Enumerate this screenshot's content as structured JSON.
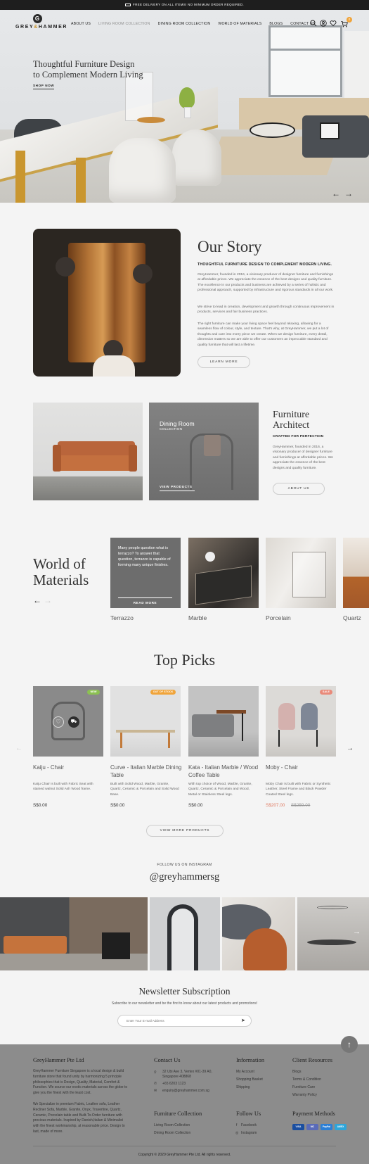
{
  "topbar": {
    "text": "FREE DELIVERY ON ALL ITEMS! NO MINIMUM ORDER REQUIRED."
  },
  "brand": {
    "initial": "G",
    "name_a": "GREY",
    "name_amp": "&",
    "name_b": "HAMMER",
    "accent": "#c9962f"
  },
  "nav": {
    "items": [
      {
        "label": "ABOUT US",
        "active": false
      },
      {
        "label": "LIVING ROOM COLLECTION",
        "active": true
      },
      {
        "label": "DINING ROOM COLLECTION",
        "active": false
      },
      {
        "label": "WORLD OF MATERIALS",
        "active": false
      },
      {
        "label": "BLOGS",
        "active": false
      },
      {
        "label": "CONTACT US",
        "active": false
      }
    ],
    "cart_count": "0",
    "icons": [
      "search-icon",
      "user-icon",
      "heart-icon",
      "cart-icon"
    ]
  },
  "hero": {
    "title_line1": "Thoughtful Furniture Design",
    "title_line2": "to Complement Modern Living",
    "cta": "SHOP NOW",
    "prev": "←",
    "next": "→"
  },
  "story": {
    "title": "Our Story",
    "subtitle": "THOUGHTFUL FURNITURE DESIGN TO COMPLEMENT MODERN LIVING.",
    "p1": "GreyHammer, founded in 2016, a visionary producer of designer furniture and furnishings at affordable prices. We appreciate the essence of the best designs and quality furniture. The excellence in our products and business are achieved by a series of holistic and professional approach, supported by infrastructure and rigorous standards in all our work.",
    "p2": "We strive to lead in creation, development and growth through continuous improvement in products, services and fair business practices.",
    "p3": "The right furniture can make your living space feel beyond relaxing, allowing for a seamless flow of colour, style, and texture. That's why, at GreyHammer, we put a lot of thoughts and care into every piece we create. When we design furniture, every detail, dimension matters so we are able to offer our customers an impeccable standard and quality furniture that will last a lifetime.",
    "button": "LEARN MORE"
  },
  "collections": {
    "dining_title": "Dining Room",
    "dining_sub": "COLLECTION",
    "dining_button": "VIEW PRODUCTS"
  },
  "architect": {
    "title_line1": "Furniture",
    "title_line2": "Architect",
    "subtitle": "CRAFTED FOR PERFECTION",
    "text": "GreyHammer, founded in 2016, a visionary producer of designer furniture and furnishings at affordable prices. We appreciate the essence of the best designs and quality furniture.",
    "button": "ABOUT US"
  },
  "materials": {
    "title_line1": "World of",
    "title_line2": "Materials",
    "prev": "←",
    "next": "→",
    "overlay_text": "Many people question what is terrazzo? To answer that question, terrazzo is capable of forming many unique finishes.",
    "overlay_button": "READ MORE",
    "items": [
      "Terrazzo",
      "Marble",
      "Porcelain",
      "Quartz"
    ]
  },
  "picks": {
    "title": "Top Picks",
    "prev": "←",
    "next": "→",
    "button": "VIEW MORE PRODUCTS",
    "items": [
      {
        "name": "Kaiju - Chair",
        "badge": "NEW",
        "badge_color": "#8cc152",
        "desc": "Kaiju Chair is built with Fabric Seat with stained walnut Solid Ash Wood frame.",
        "price": "S$0.00",
        "old_price": ""
      },
      {
        "name": "Curve - Italian Marble Dining Table",
        "badge": "OUT OF STOCK",
        "badge_color": "#f0a43a",
        "desc": "Built with Solid Wood, Marble, Granite, Quartz, Ceramic & Porcelain and Solid Wood Base.",
        "price": "S$0.00",
        "old_price": ""
      },
      {
        "name": "Kata - Italian Marble / Wood Coffee Table",
        "badge": "",
        "badge_color": "",
        "desc": "With top choice of Wood, Marble, Granite, Quartz, Ceramic & Porcelain and Wood, Metal or Stainless Steel legs.",
        "price": "S$0.00",
        "old_price": ""
      },
      {
        "name": "Moby - Chair",
        "badge": "SALE",
        "badge_color": "#e98a7a",
        "desc": "Moby Chair is built with Fabric or Synthetic Leather, Steel Frame and Black Powder Coated Steel legs.",
        "price": "S$207.00",
        "old_price": "S$259.00"
      }
    ]
  },
  "instagram": {
    "label": "FOLLOW US ON INSTAGRAM",
    "handle": "@greyhammersg",
    "next": "→"
  },
  "newsletter": {
    "title": "Newsletter Subscription",
    "text": "Subscribe to our newsletter and be the first to know about our latest products and promotions!",
    "placeholder": "Enter Your E-mail Address",
    "send": "➤"
  },
  "to_top": "↑",
  "footer": {
    "about_title": "GreyHammer Pte Ltd",
    "about_p1": "GreyHammer Furniture Singapore is a local design & build furniture store that found unity by harmonizing 5 principle philosophies that is Design, Quality, Material, Comfort & Function. We source our exotic materials across the globe to give you the finest with the least cost.",
    "about_p2": "We Specialize in premium Fabric, Leather sofa, Leather Recliner Sofa, Marble, Granite, Onyx, Travertine, Quartz, Ceramic, Porcelain table and Built-To-Order furniture with precious materials. Inspired by Danish,Italian & Minimalist with the finest workmanship, at reasonable price. Design to last, made of more.",
    "contact_title": "Contact Us",
    "address_line1": "32 Ubi Ave 3, Vertex #01-39 A0,",
    "address_line2": "Singapore 408868",
    "phone": "+65 6203 1123",
    "email": "enquiry@greyhammer.com.sg",
    "info_title": "Information",
    "info_links": [
      "My Account",
      "Shopping Basket",
      "Shipping"
    ],
    "res_title": "Client Resources",
    "res_links": [
      "Blogs",
      "Terms & Condition",
      "Furniture Care",
      "Warranty Policy"
    ],
    "collection_title": "Furniture Collection",
    "collection_links": [
      "Living Room Collection",
      "Dining Room Collection"
    ],
    "follow_title": "Follow Us",
    "follow_links": [
      "Facebook",
      "Instagram"
    ],
    "pay_title": "Payment Methods",
    "pay_methods": [
      "VISA",
      "MC",
      "PayPal",
      "AMEX"
    ],
    "copyright": "Copyright © 2020 GreyHammer Pte Ltd. All rights reserved."
  }
}
